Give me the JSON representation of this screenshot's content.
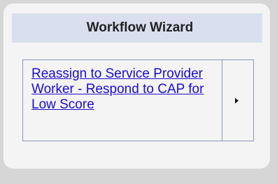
{
  "widget": {
    "title": "Workflow Wizard",
    "items": [
      {
        "label": "Reassign to Service Provider Worker - Respond to CAP for Low Score",
        "action_icon": "triangle-right-icon"
      }
    ]
  }
}
